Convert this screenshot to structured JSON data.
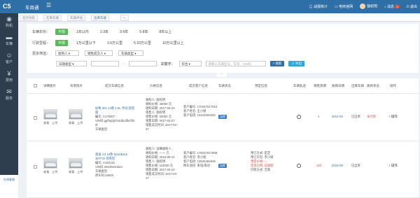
{
  "app": {
    "logo": "C5",
    "title": "车商通",
    "menu_icon": "grid-icon"
  },
  "topbar": {
    "items": [
      {
        "icon": "chart-icon",
        "label": "战报统计"
      },
      {
        "icon": "monitor-icon",
        "label": "电商官网"
      },
      {
        "icon": "avatar",
        "label": "骆权明"
      },
      {
        "icon": "bell-icon",
        "label": "消息",
        "badge": "2"
      },
      {
        "icon": "logout-icon",
        "label": "退出"
      }
    ]
  },
  "sidebar": {
    "items": [
      {
        "icon": "camera-icon",
        "label": "购机"
      },
      {
        "icon": "car-icon",
        "label": "车辆"
      },
      {
        "icon": "user-icon",
        "label": "客户"
      },
      {
        "icon": "money-icon",
        "label": "费用"
      },
      {
        "icon": "service-icon",
        "label": "服务"
      }
    ],
    "bottom_label": "在线客服"
  },
  "tabs": [
    {
      "label": "首页导航"
    },
    {
      "label": "在库车辆"
    },
    {
      "label": "车辆评估"
    },
    {
      "label": "出库车辆"
    }
  ],
  "filters": {
    "age": {
      "label": "车辆年份：",
      "options": [
        "不限",
        "1年以内",
        "1-3年",
        "3-5年",
        "5-8年",
        "8年以上"
      ],
      "selected": 0
    },
    "mileage": {
      "label": "行驶里程：",
      "options": [
        "不限",
        "1万公里以下",
        "1-5万公里",
        "5-10万公里",
        "10万公里以上"
      ],
      "selected": 0
    },
    "more": {
      "label": "更多筛选：",
      "selects": [
        "收购人",
        "销售成交人",
        "车辆类型"
      ]
    },
    "date_type": "日期类型",
    "keyword_type": "综合",
    "keyword_label": "关键字：",
    "keyword_placeholder": "请输入车辆型号、车架、VIN码",
    "search_label": "搜索",
    "export_label": "导出",
    "collapse": "⌃"
  },
  "table": {
    "headers": [
      "详细图片",
      "背景照片",
      "成交车辆信息",
      "价格信息",
      "成交客户信息",
      "车辆状态",
      "预定信息",
      "车辆轨迹",
      "销售周期",
      "按揭日期",
      "出库车辆",
      "收款状态",
      "操作"
    ],
    "rows": [
      {
        "thumb_labels": [
          "查看",
          "上传"
        ],
        "vehicle": [
          "标致 301 14款 1.6L 手动 舒适版",
          "编号: A170007",
          "VIN码:ggfhgfghf44dbcdfbcfhhdf",
          "车辆类型:"
        ],
        "price": [
          "收购人: 骆权明",
          "收购价格: 46000 元",
          "收购日期: 2017-03-23",
          "销售人: 骆权明",
          "销售价格: 50000 元",
          "销售日期: 2017-03-27",
          "销售成交时间: 2017-03-27"
        ],
        "customer": [
          "客户编号: 170227017810",
          "客户姓名: 王小姐",
          "客户电话: 13243253252"
        ],
        "status": "出库",
        "reservation": [],
        "cycle": "4",
        "date": "2014-03",
        "outbound": "已出库",
        "payment": "未付款",
        "action": "+ 操作"
      },
      {
        "thumb_labels": [
          "查看",
          "上传"
        ],
        "vehicle": [
          "奥迪 A3 16款 Sportback 35TFSI 领英型",
          "编号: A160116",
          "VIN码:34235234524",
          "车辆类型:",
          "原车码:34634"
        ],
        "price": [
          "收购人: 详细收购人",
          "收购价格: ------ 元",
          "收购日期: 2016-09-12",
          "销售人: 骆权明",
          "销售价格: 110000 元",
          "销售日期: 2017-03-22",
          "销售成交时间: 2017-03-27"
        ],
        "customer": [
          "客户编号: 170227017808",
          "客户姓名: 李小姐",
          "客户电话: 13545454545",
          "购车途径: 来电/来访"
        ],
        "status": "出库",
        "reservation": [
          "预订方式: 定定",
          "预订车型: 李小姐",
          "预定价格: ---",
          "定金比例: 已收取",
          "付款方式: 全款"
        ],
        "cycle": "192",
        "date": "2016-08",
        "outbound": "已出库",
        "payment": "",
        "action": "+ 操作"
      }
    ]
  }
}
